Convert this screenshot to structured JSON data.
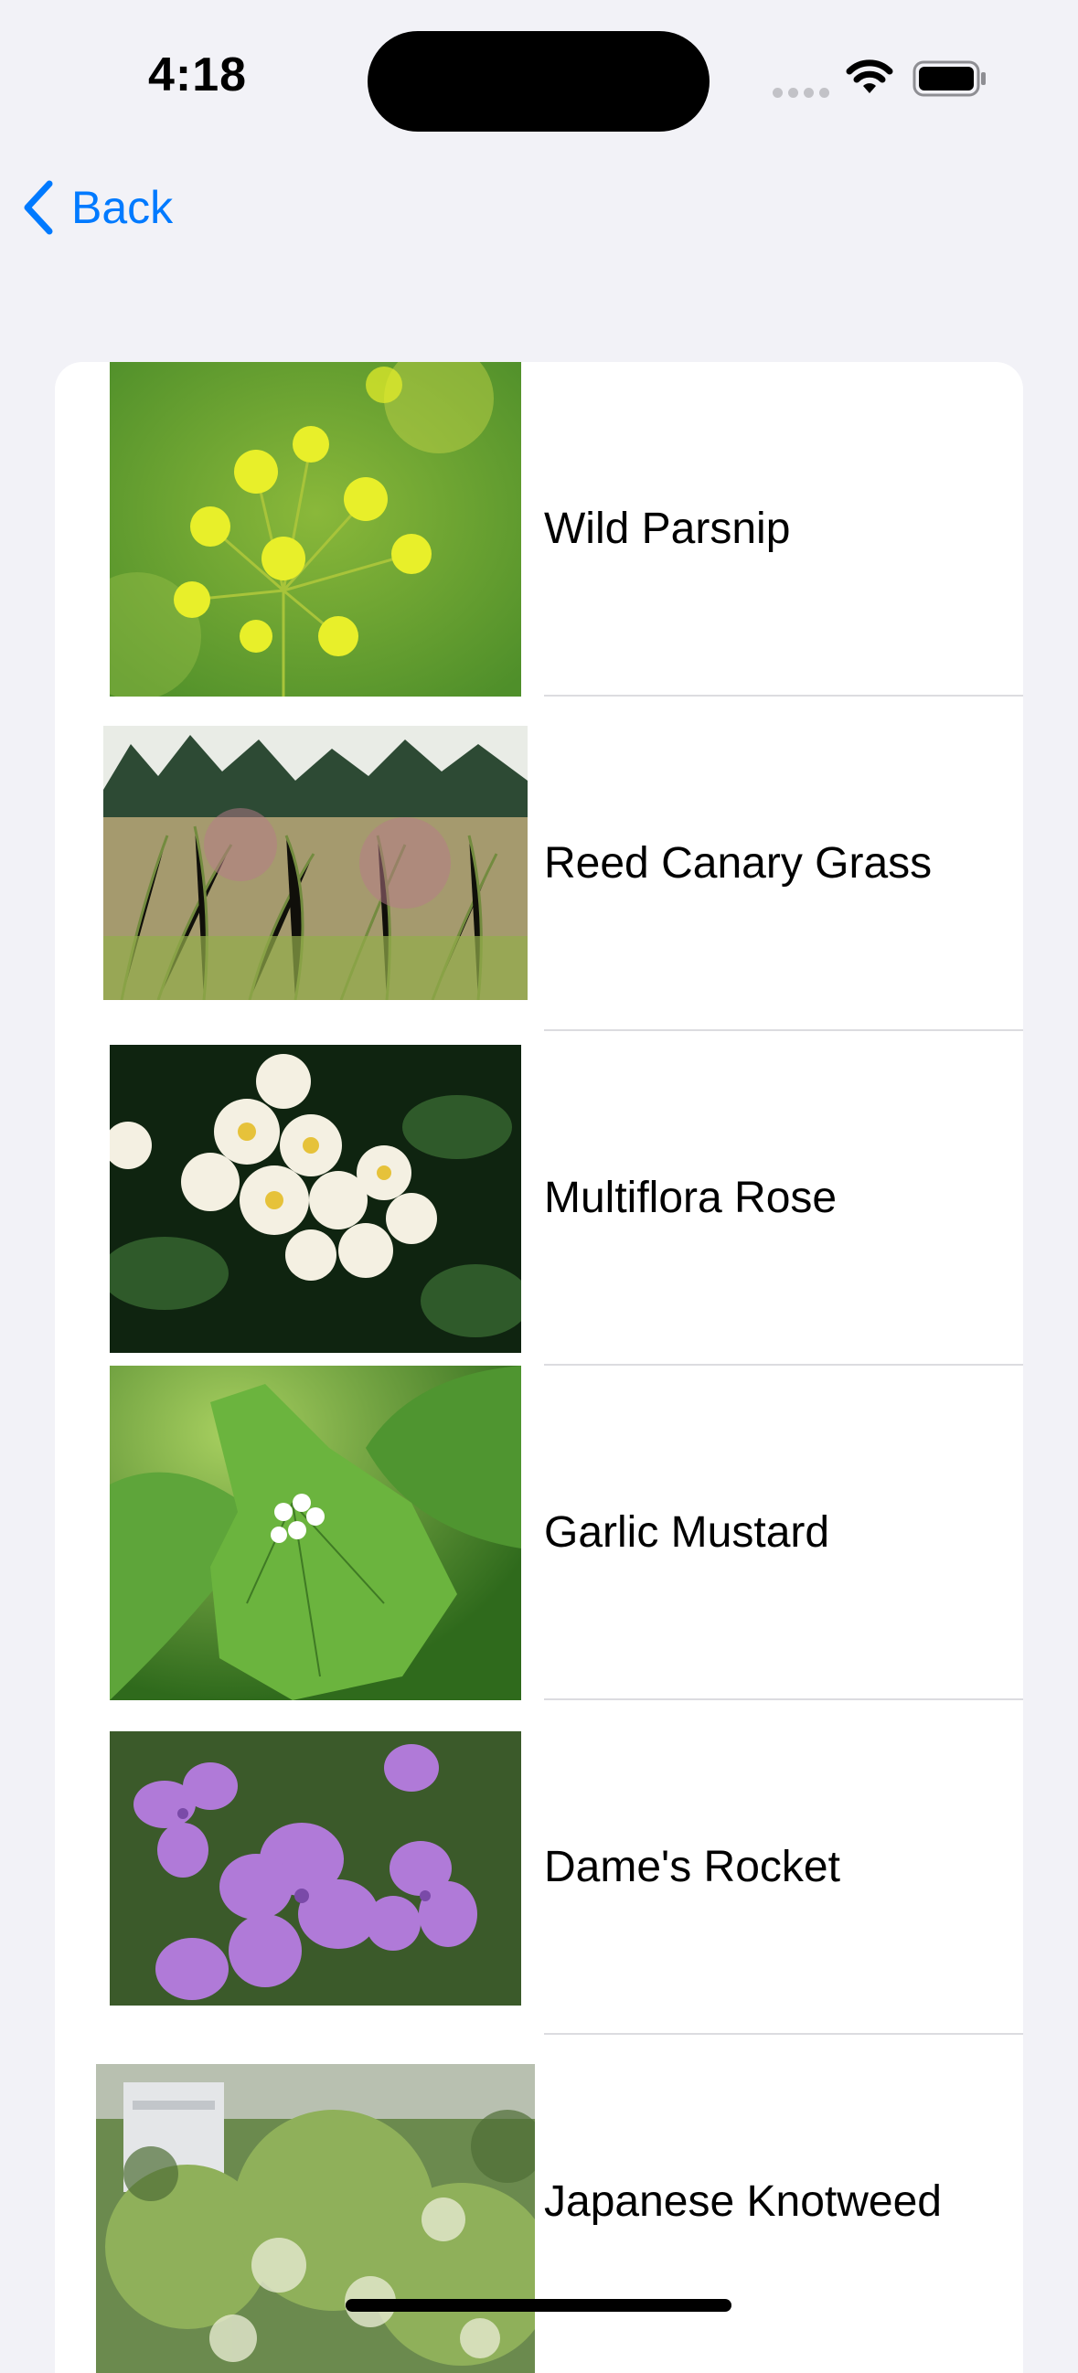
{
  "status_bar": {
    "time": "4:18",
    "icons": [
      "cellular-signal-icon",
      "wifi-icon",
      "battery-icon"
    ]
  },
  "nav": {
    "back_label": "Back",
    "accent_color": "#007aff"
  },
  "plants": [
    {
      "name": "Wild Parsnip",
      "image": "wild-parsnip-photo"
    },
    {
      "name": "Reed Canary Grass",
      "image": "reed-canary-grass-photo"
    },
    {
      "name": "Multiflora Rose",
      "image": "multiflora-rose-photo"
    },
    {
      "name": "Garlic Mustard",
      "image": "garlic-mustard-photo"
    },
    {
      "name": "Dame's Rocket",
      "image": "dames-rocket-photo"
    },
    {
      "name": "Japanese Knotweed",
      "image": "japanese-knotweed-photo"
    }
  ]
}
